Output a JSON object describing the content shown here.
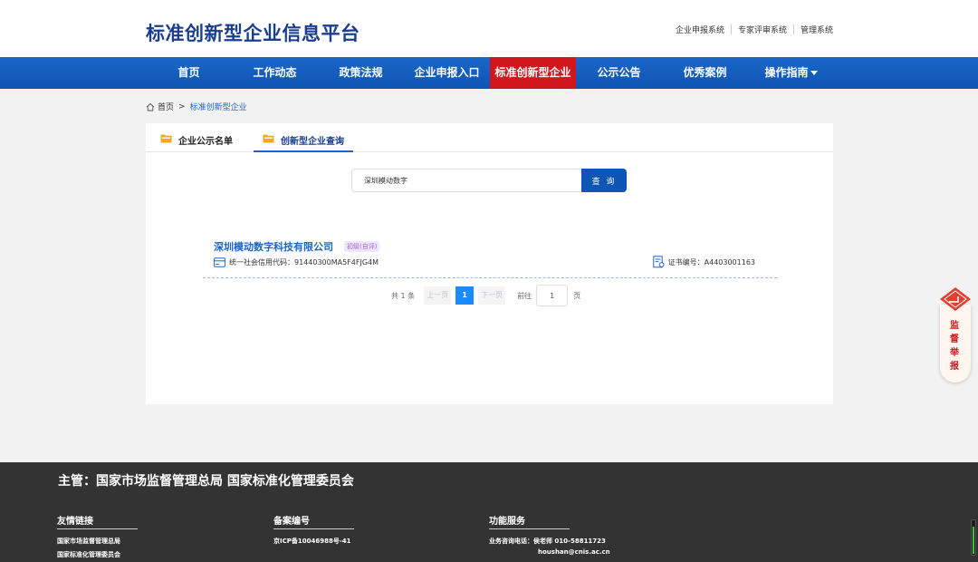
{
  "header": {
    "site_title": "标准创新型企业信息平台",
    "top_links": [
      "企业申报系统",
      "专家评审系统",
      "管理系统"
    ]
  },
  "nav": {
    "items": [
      "首页",
      "工作动态",
      "政策法规",
      "企业申报入口",
      "标准创新型企业",
      "公示公告",
      "优秀案例",
      "操作指南"
    ],
    "active_index": 4,
    "active_color": "#d2161d",
    "bar_color": "#1a66c8"
  },
  "breadcrumb": {
    "home": "首页",
    "separator": ">",
    "current": "标准创新型企业"
  },
  "tabs": [
    "企业公示名单",
    "创新型企业查询"
  ],
  "search": {
    "value": "深圳模动数字",
    "button_label": "查 询"
  },
  "results": [
    {
      "company": "深圳模动数字科技有限公司",
      "level": "初级(自评)",
      "credit_label": "统一社会信用代码：",
      "credit_code": "91440300MA5F4FJG4M",
      "cert_label": "证书编号：",
      "cert_no": "A4403001163"
    }
  ],
  "pager": {
    "total": "共 1 条",
    "prev": "上一页",
    "current": "1",
    "next": "下一页",
    "goto": "前往",
    "goto_value": "1",
    "page_unit": "页"
  },
  "report_button": {
    "chars": [
      "监",
      "督",
      "举",
      "报"
    ]
  },
  "footer": {
    "sponsor": "主管：国家市场监督管理总局 国家标准化管理委员会",
    "links_title": "友情链接",
    "links": [
      "国家市场监督管理总局",
      "国家标准化管理委员会"
    ],
    "icp_title": "备案编号",
    "icp": "京ICP备10046988号-41",
    "service_title": "功能服务",
    "service_phone": "业务咨询电话：侯老师 010-58811723",
    "service_email": "houshan@cnis.ac.cn"
  }
}
